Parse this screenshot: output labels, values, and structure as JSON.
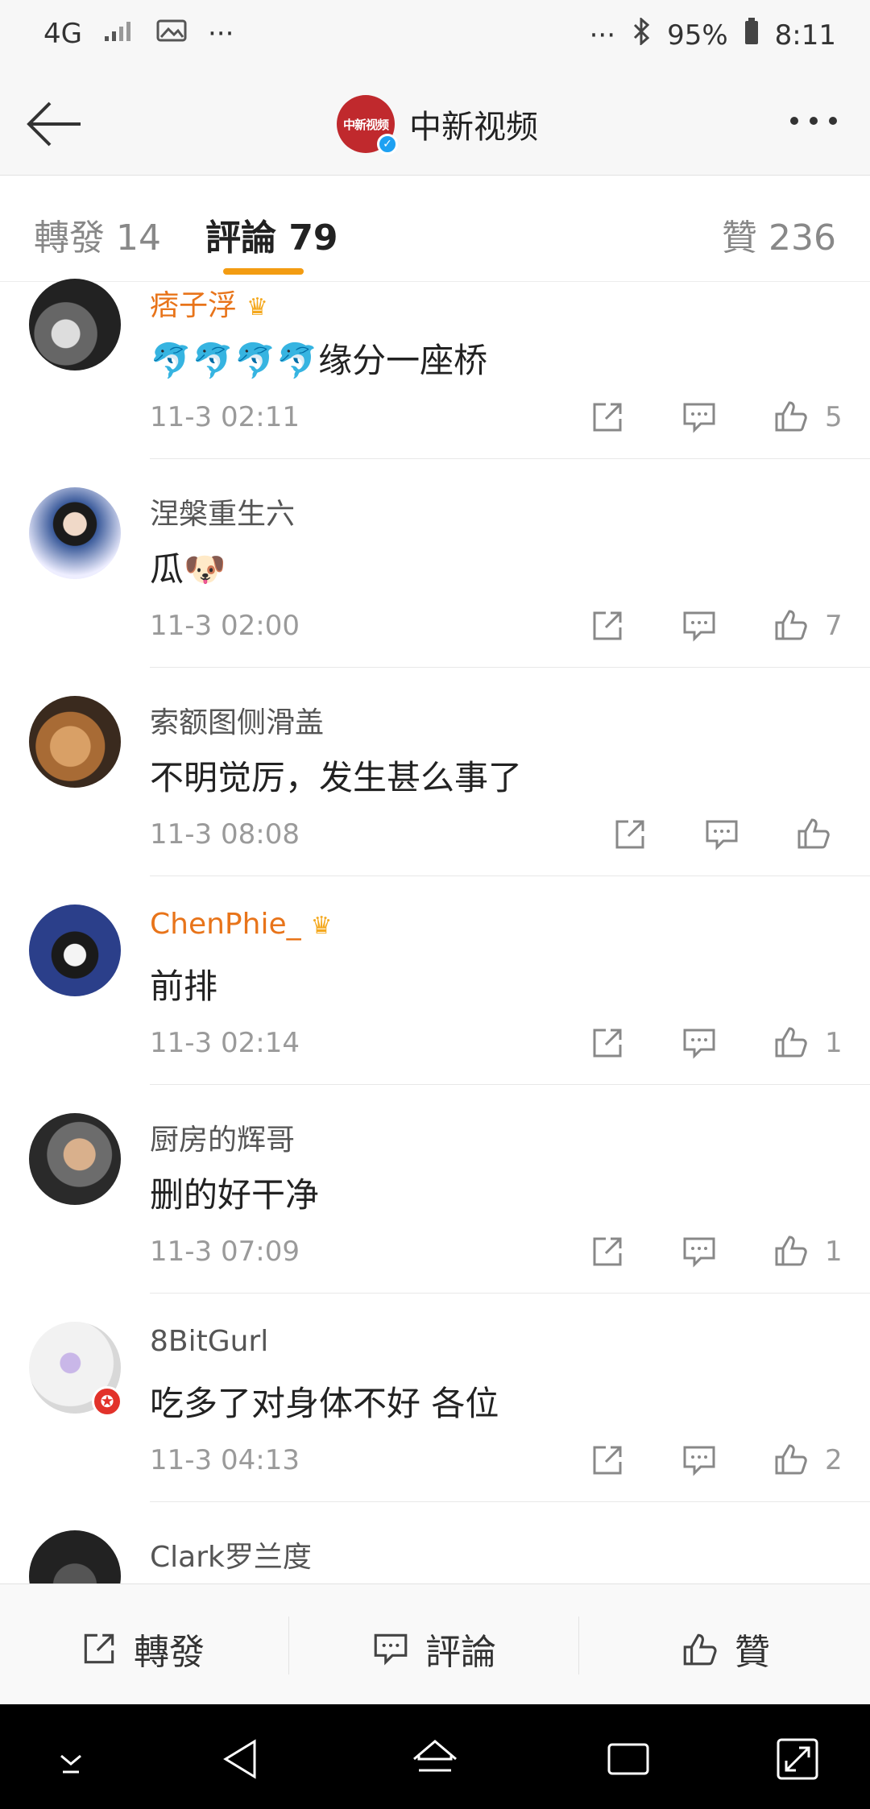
{
  "status_bar": {
    "network": "4G",
    "battery": "95%",
    "time": "8:11",
    "more_left": "···",
    "more_right": "···"
  },
  "header": {
    "logo_text": "中新视频",
    "title": "中新视频"
  },
  "tabs": {
    "repost": "轉發 14",
    "comments": "評論 79",
    "likes": "贊 236"
  },
  "comments": [
    {
      "user": "痞子浮",
      "vip": true,
      "text": "🐬🐬🐬🐬缘分一座桥",
      "time": "11-3 02:11",
      "likes": "5"
    },
    {
      "user": "涅槃重生六",
      "vip": false,
      "text": "瓜🐶",
      "time": "11-3 02:00",
      "likes": "7"
    },
    {
      "user": "索额图侧滑盖",
      "vip": false,
      "text": "不明觉厉，发生甚么事了",
      "time": "11-3 08:08",
      "likes": ""
    },
    {
      "user": "ChenPhie_",
      "vip": true,
      "text": "前排",
      "time": "11-3 02:14",
      "likes": "1"
    },
    {
      "user": "厨房的辉哥",
      "vip": false,
      "text": "删的好干净",
      "time": "11-3 07:09",
      "likes": "1"
    },
    {
      "user": "8BitGurl",
      "vip": false,
      "text": "吃多了对身体不好 各位",
      "time": "11-3 04:13",
      "likes": "2"
    },
    {
      "user": "Clark罗兰度",
      "vip": false,
      "text": "",
      "time": "",
      "likes": ""
    }
  ],
  "bottom_bar": {
    "repost": "轉發",
    "comment": "評論",
    "like": "贊"
  },
  "colors": {
    "vip_name": "#e8741a",
    "tab_indicator": "#f39c12",
    "brand_red": "#c0292d",
    "verified_blue": "#1ea1f2"
  }
}
